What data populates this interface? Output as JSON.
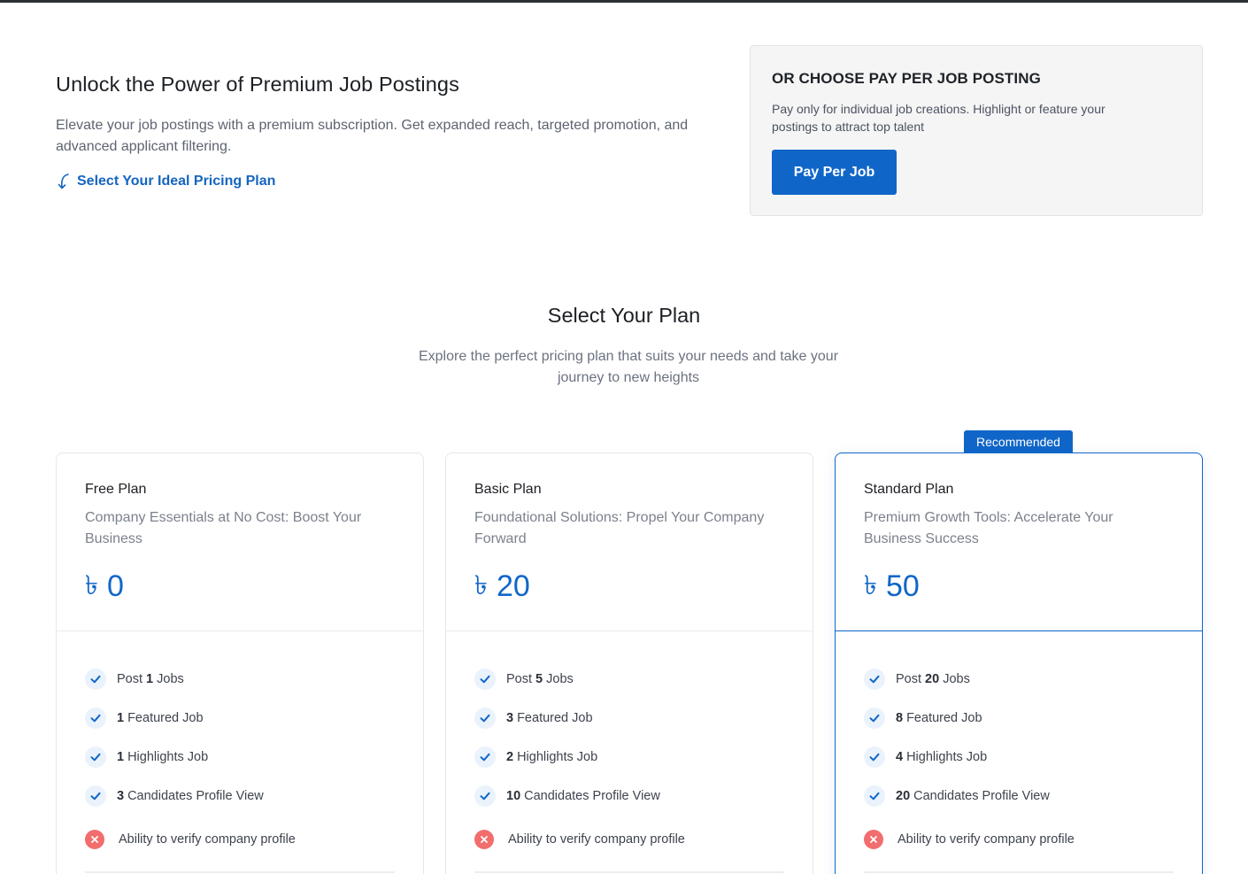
{
  "hero": {
    "title": "Unlock the Power of Premium Job Postings",
    "description": "Elevate your job postings with a premium subscription. Get expanded reach, targeted promotion, and advanced applicant filtering.",
    "cta_link": "Select Your Ideal Pricing Plan"
  },
  "pay_per_job": {
    "title": "OR CHOOSE PAY PER JOB POSTING",
    "description": "Pay only for individual job creations. Highlight or feature your postings to attract top talent",
    "button_label": "Pay Per Job"
  },
  "plans_section": {
    "title": "Select Your Plan",
    "subtitle": "Explore the perfect pricing plan that suits your needs and take your journey to new heights"
  },
  "badge": "Recommended",
  "currency_symbol": "৳",
  "plans": [
    {
      "name": "Free Plan",
      "description": "Company Essentials at No Cost: Boost Your Business",
      "price": "0",
      "features": [
        {
          "pre": "Post",
          "num": "1",
          "post": "Jobs"
        },
        {
          "num": "1",
          "post": "Featured Job"
        },
        {
          "num": "1",
          "post": "Highlights Job"
        },
        {
          "num": "3",
          "post": "Candidates Profile View"
        }
      ],
      "missing_feature": "Ability to verify company profile"
    },
    {
      "name": "Basic Plan",
      "description": "Foundational Solutions: Propel Your Company Forward",
      "price": "20",
      "features": [
        {
          "pre": "Post",
          "num": "5",
          "post": "Jobs"
        },
        {
          "num": "3",
          "post": "Featured Job"
        },
        {
          "num": "2",
          "post": "Highlights Job"
        },
        {
          "num": "10",
          "post": "Candidates Profile View"
        }
      ],
      "missing_feature": "Ability to verify company profile"
    },
    {
      "name": "Standard Plan",
      "description": "Premium Growth Tools: Accelerate Your Business Success",
      "price": "50",
      "features": [
        {
          "pre": "Post",
          "num": "20",
          "post": "Jobs"
        },
        {
          "num": "8",
          "post": "Featured Job"
        },
        {
          "num": "4",
          "post": "Highlights Job"
        },
        {
          "num": "20",
          "post": "Candidates Profile View"
        }
      ],
      "missing_feature": "Ability to verify company profile"
    }
  ],
  "colors": {
    "accent": "#1066c8",
    "danger": "#f26d6d",
    "check_bg": "#eaf2fc"
  }
}
